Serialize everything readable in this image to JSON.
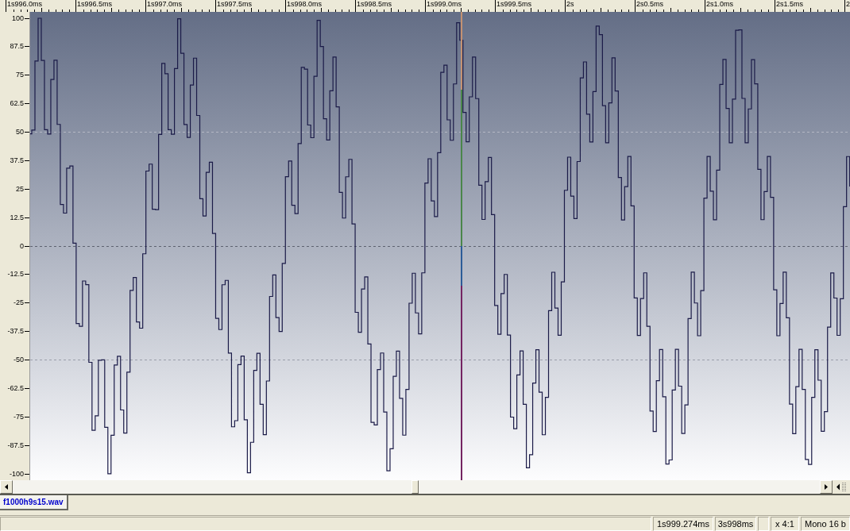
{
  "time_ruler": {
    "labels": [
      "1s996.0ms",
      "1s996.5ms",
      "1s997.0ms",
      "1s997.5ms",
      "1s998.0ms",
      "1s998.5ms",
      "1s999.0ms",
      "1s999.5ms",
      "2s",
      "2s0.5ms",
      "2s1.0ms",
      "2s1.5ms",
      "2"
    ]
  },
  "amplitude_axis": {
    "labels": [
      "100",
      "87.5",
      "75",
      "62.5",
      "50",
      "37.5",
      "25",
      "12.5",
      "0",
      "-12.5",
      "-25",
      "-37.5",
      "-50",
      "-62.5",
      "-75",
      "-87.5",
      "-100"
    ]
  },
  "tabs": [
    {
      "label": "f1000h9s15.wav",
      "selected": true
    }
  ],
  "status_bar": {
    "panels": [
      {
        "kind": "empty"
      },
      {
        "kind": "text",
        "text": "1s999.274ms"
      },
      {
        "kind": "text",
        "text": "3s998ms"
      },
      {
        "kind": "empty"
      },
      {
        "kind": "text",
        "text": "x 4:1"
      },
      {
        "kind": "text",
        "text": "Mono 16 b"
      }
    ]
  }
}
